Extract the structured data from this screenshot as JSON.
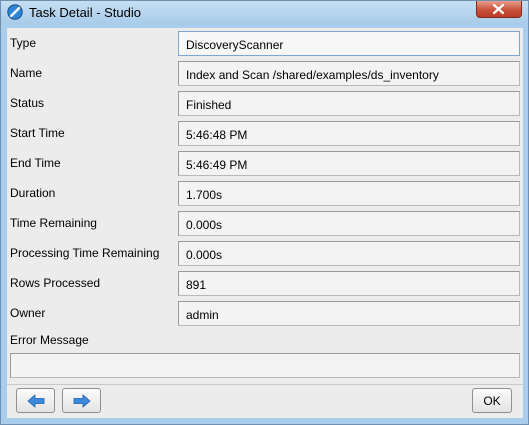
{
  "window": {
    "title": "Task Detail - Studio"
  },
  "fields": [
    {
      "label": "Type",
      "value": "DiscoveryScanner"
    },
    {
      "label": "Name",
      "value": "Index and Scan /shared/examples/ds_inventory"
    },
    {
      "label": "Status",
      "value": "Finished"
    },
    {
      "label": "Start Time",
      "value": "5:46:48 PM"
    },
    {
      "label": "End Time",
      "value": "5:46:49 PM"
    },
    {
      "label": "Duration",
      "value": "1.700s"
    },
    {
      "label": "Time Remaining",
      "value": "0.000s"
    },
    {
      "label": "Processing Time Remaining",
      "value": "0.000s"
    },
    {
      "label": "Rows Processed",
      "value": "891"
    },
    {
      "label": "Owner",
      "value": "admin"
    }
  ],
  "error_message": {
    "label": "Error Message",
    "value": ""
  },
  "buttons": {
    "ok_label": "OK",
    "back_icon": "arrow-left-icon",
    "forward_icon": "arrow-right-icon"
  },
  "colors": {
    "frame": "#a9cdea",
    "close": "#c9513b",
    "arrow": "#2f7fd6"
  }
}
